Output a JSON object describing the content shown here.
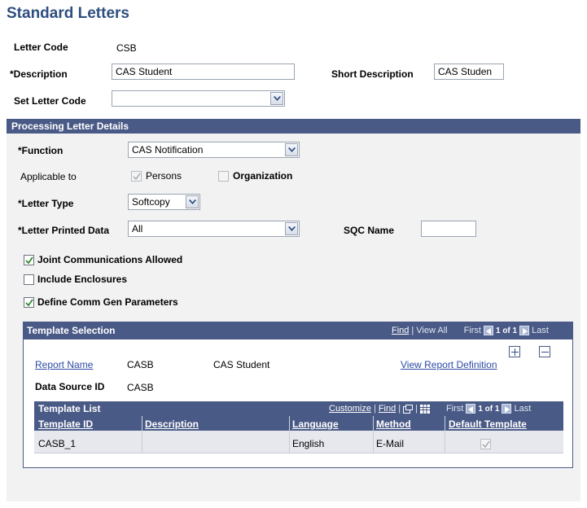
{
  "page": {
    "title": "Standard Letters"
  },
  "header_fields": {
    "letter_code_label": "Letter Code",
    "letter_code_value": "CSB",
    "description_label": "*Description",
    "description_value": "CAS Student",
    "short_description_label": "Short Description",
    "short_description_value": "CAS Studen",
    "set_letter_code_label": "Set Letter Code",
    "set_letter_code_value": ""
  },
  "processing": {
    "section_title": "Processing Letter Details",
    "function_label": "*Function",
    "function_value": "CAS Notification",
    "applicable_to_label": "Applicable to",
    "persons_label": "Persons",
    "persons_checked": true,
    "organization_label": "Organization",
    "organization_checked": false,
    "letter_type_label": "*Letter Type",
    "letter_type_value": "Softcopy",
    "letter_printed_data_label": "*Letter Printed Data",
    "letter_printed_data_value": "All",
    "sqc_name_label": "SQC Name",
    "sqc_name_value": "",
    "joint_comm_label": "Joint Communications Allowed",
    "joint_comm_checked": true,
    "include_enclosures_label": "Include Enclosures",
    "include_enclosures_checked": false,
    "define_comm_gen_label": "Define Comm Gen Parameters",
    "define_comm_gen_checked": true
  },
  "template_selection": {
    "title": "Template Selection",
    "find_link": "Find",
    "view_all": "View All",
    "first": "First",
    "pager": "1 of 1",
    "last": "Last",
    "report_name_link": "Report Name",
    "report_name_value": "CASB",
    "report_description": "CAS Student",
    "view_report_definition_link": "View Report Definition",
    "data_source_id_label": "Data Source ID",
    "data_source_id_value": "CASB"
  },
  "template_list": {
    "title": "Template List",
    "customize_link": "Customize",
    "find_link": "Find",
    "first": "First",
    "pager": "1 of 1",
    "last": "Last",
    "columns": [
      "Template ID",
      "Description",
      "Language",
      "Method",
      "Default Template"
    ],
    "rows": [
      {
        "template_id": "CASB_1",
        "description": "",
        "language": "English",
        "method": "E-Mail",
        "default_template": true
      }
    ]
  },
  "colors": {
    "title_blue": "#2f4f80",
    "header_bar": "#4a5a86",
    "link_blue": "#2b4aa5",
    "group_bg": "#f2f2f2"
  },
  "icons": {
    "dropdown": "chevron-down-icon",
    "check": "checkmark-icon",
    "nav_prev": "triangle-left-icon",
    "nav_next": "triangle-right-icon",
    "add_row": "plus-icon",
    "delete_row": "minus-icon",
    "view_grid": "new-window-icon",
    "download": "grid-download-icon"
  }
}
